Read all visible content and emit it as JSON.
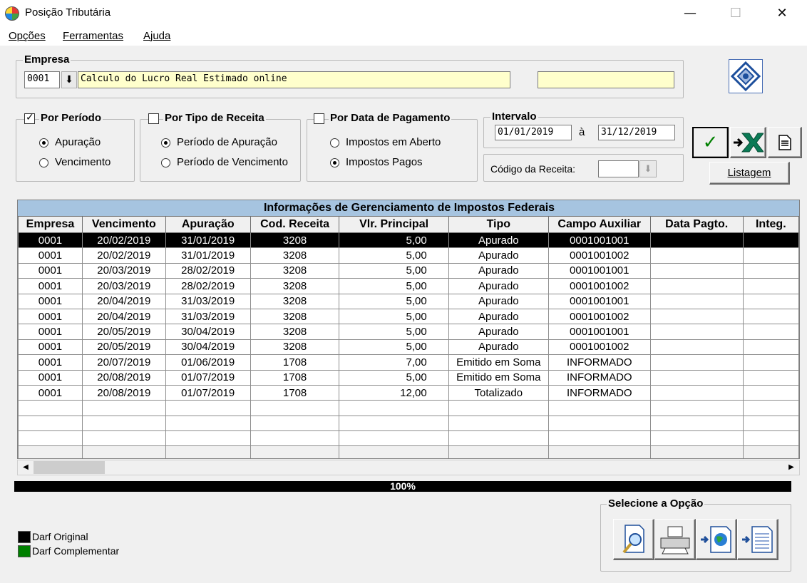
{
  "window": {
    "title": "Posição Tributária",
    "minimize": "—",
    "maximize": "☐",
    "close": "✕"
  },
  "menu": [
    "Opções",
    "Ferramentas",
    "Ajuda"
  ],
  "empresa": {
    "legend": "Empresa",
    "code": "0001",
    "name": "Calculo do Lucro Real Estimado online",
    "extra": ""
  },
  "por_periodo": {
    "legend": "Por Período",
    "checked": true,
    "options": [
      "Apuração",
      "Vencimento"
    ],
    "selected": 0
  },
  "por_tipo_receita": {
    "legend": "Por Tipo de Receita",
    "checked": false,
    "options": [
      "Período de Apuração",
      "Período de Vencimento"
    ],
    "selected": 0
  },
  "por_data_pagamento": {
    "legend": "Por Data de Pagamento",
    "checked": false,
    "options": [
      "Impostos em Aberto",
      "Impostos Pagos"
    ],
    "selected": 1
  },
  "intervalo": {
    "legend": "Intervalo",
    "start": "01/01/2019",
    "sep": "à",
    "end": "31/12/2019"
  },
  "codigo_receita": {
    "label": "Código da Receita:",
    "value": ""
  },
  "buttons": {
    "listagem": "Listagem",
    "confirm_icon": "check-icon",
    "excel_icon": "excel-export-icon",
    "doc_icon": "document-icon"
  },
  "grid": {
    "caption": "Informações de Gerenciamento de Impostos Federais",
    "columns": [
      "Empresa",
      "Vencimento",
      "Apuração",
      "Cod. Receita",
      "Vlr. Principal",
      "Tipo",
      "Campo Auxiliar",
      "Data Pagto.",
      "Integ."
    ],
    "rows": [
      [
        "0001",
        "20/02/2019",
        "31/01/2019",
        "3208",
        "5,00",
        "Apurado",
        "0001001001",
        "",
        ""
      ],
      [
        "0001",
        "20/02/2019",
        "31/01/2019",
        "3208",
        "5,00",
        "Apurado",
        "0001001002",
        "",
        ""
      ],
      [
        "0001",
        "20/03/2019",
        "28/02/2019",
        "3208",
        "5,00",
        "Apurado",
        "0001001001",
        "",
        ""
      ],
      [
        "0001",
        "20/03/2019",
        "28/02/2019",
        "3208",
        "5,00",
        "Apurado",
        "0001001002",
        "",
        ""
      ],
      [
        "0001",
        "20/04/2019",
        "31/03/2019",
        "3208",
        "5,00",
        "Apurado",
        "0001001001",
        "",
        ""
      ],
      [
        "0001",
        "20/04/2019",
        "31/03/2019",
        "3208",
        "5,00",
        "Apurado",
        "0001001002",
        "",
        ""
      ],
      [
        "0001",
        "20/05/2019",
        "30/04/2019",
        "3208",
        "5,00",
        "Apurado",
        "0001001001",
        "",
        ""
      ],
      [
        "0001",
        "20/05/2019",
        "30/04/2019",
        "3208",
        "5,00",
        "Apurado",
        "0001001002",
        "",
        ""
      ],
      [
        "0001",
        "20/07/2019",
        "01/06/2019",
        "1708",
        "7,00",
        "Emitido em Soma",
        "INFORMADO",
        "",
        ""
      ],
      [
        "0001",
        "20/08/2019",
        "01/07/2019",
        "1708",
        "5,00",
        "Emitido em Soma",
        "INFORMADO",
        "",
        ""
      ],
      [
        "0001",
        "20/08/2019",
        "01/07/2019",
        "1708",
        "12,00",
        "Totalizado",
        "INFORMADO",
        "",
        ""
      ]
    ],
    "selected_row": 0,
    "empty_rows": 3
  },
  "progress": {
    "value": 1.0,
    "label": "100%"
  },
  "legend_colors": [
    {
      "label": "Darf Original",
      "color": "#000000"
    },
    {
      "label": "Darf Complementar",
      "color": "#008000"
    }
  ],
  "selecione": {
    "legend": "Selecione a Opção",
    "icons": [
      "preview-icon",
      "printer-icon",
      "web-export-icon",
      "file-export-icon"
    ]
  },
  "colors": {
    "caption_bg": "#a6c4e0",
    "selected_row_bg": "#000000",
    "edit_yellow": "#ffffcc"
  }
}
